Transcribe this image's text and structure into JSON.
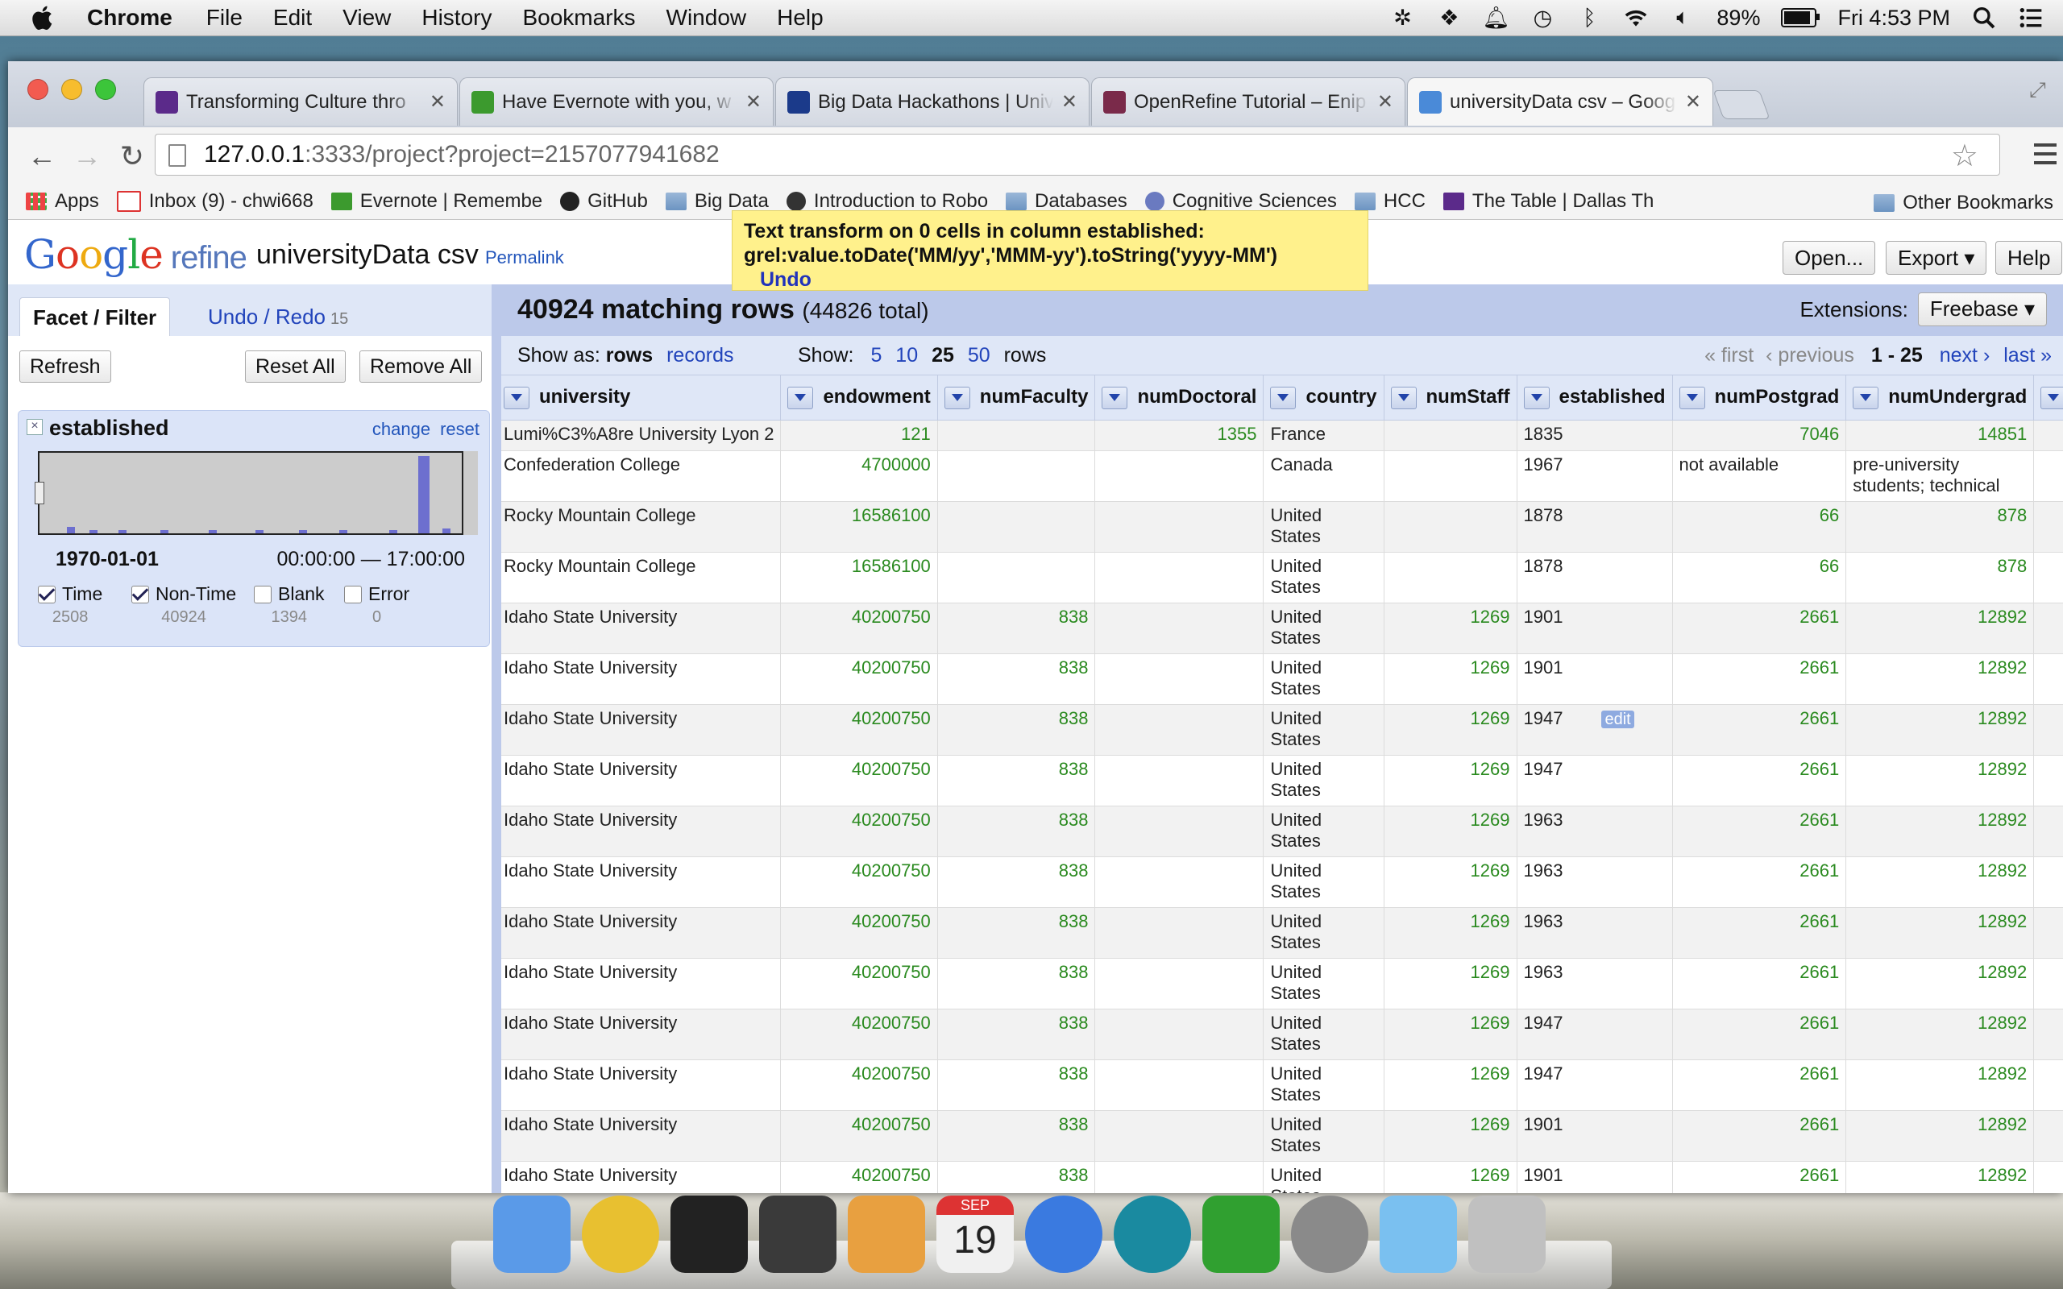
{
  "menubar": {
    "app_name": "Chrome",
    "items": [
      "File",
      "Edit",
      "View",
      "History",
      "Bookmarks",
      "Window",
      "Help"
    ],
    "battery_percent": "89%",
    "battery_level": 0.89,
    "clock": "Fri 4:53 PM"
  },
  "tabs": [
    {
      "title": "Transforming Culture thro",
      "active": false,
      "favicon_color": "#5b2a8a"
    },
    {
      "title": "Have Evernote with you, w",
      "active": false,
      "favicon_color": "#3c9a2e"
    },
    {
      "title": "Big Data Hackathons | Univ",
      "active": false,
      "favicon_color": "#1b3a8a"
    },
    {
      "title": "OpenRefine Tutorial – Enip",
      "active": false,
      "favicon_color": "#7a2a4a"
    },
    {
      "title": "universityData csv – Googl",
      "active": true,
      "favicon_color": "#4a8ad8"
    }
  ],
  "address": {
    "host": "127.0.0.1",
    "path": ":3333/project?project=2157077941682"
  },
  "bookmarks": [
    {
      "label": "Apps",
      "icon": "apps-grid-icon"
    },
    {
      "label": "Inbox (9) - chwi668",
      "icon": "gmail-icon"
    },
    {
      "label": "Evernote | Remembe",
      "icon": "evernote-icon"
    },
    {
      "label": "GitHub",
      "icon": "github-icon"
    },
    {
      "label": "Big Data",
      "icon": "folder-icon"
    },
    {
      "label": "Introduction to Robo",
      "icon": "robot-icon"
    },
    {
      "label": "Databases",
      "icon": "folder-icon"
    },
    {
      "label": "Cognitive Sciences",
      "icon": "gear-icon"
    },
    {
      "label": "HCC",
      "icon": "folder-icon"
    },
    {
      "label": "The Table | Dallas Th",
      "icon": "page-icon"
    }
  ],
  "other_bookmarks": "Other Bookmarks",
  "refine": {
    "logo_google": "Google",
    "logo_refine": "refine",
    "project_name": "universityData csv",
    "permalink": "Permalink",
    "notification_line1": "Text transform on 0 cells in column established:",
    "notification_line2": "grel:value.toDate('MM/yy','MMM-yy').toString('yyyy-MM')",
    "notification_undo": "Undo",
    "open_label": "Open...",
    "export_label": "Export ▾",
    "help_label": "Help"
  },
  "left": {
    "tab_facet": "Facet / Filter",
    "tab_undo": "Undo / Redo",
    "undo_count": "15",
    "refresh": "Refresh",
    "reset_all": "Reset All",
    "remove_all": "Remove All"
  },
  "facet": {
    "close": "×",
    "title": "established",
    "change": "change",
    "reset": "reset",
    "range_from": "1970-01-01",
    "range_to": "00:00:00 — 17:00:00",
    "checks": [
      {
        "label": "Time",
        "checked": true,
        "count": "2508"
      },
      {
        "label": "Non-Time",
        "checked": true,
        "count": "40924"
      },
      {
        "label": "Blank",
        "checked": false,
        "count": "1394"
      },
      {
        "label": "Error",
        "checked": false,
        "count": "0"
      }
    ]
  },
  "summary": {
    "matching": "40924 matching rows",
    "total": "(44826 total)",
    "extensions_label": "Extensions:",
    "extensions_btn": "Freebase ▾"
  },
  "viewbar": {
    "show_as": "Show as:",
    "rows": "rows",
    "records": "records",
    "show": "Show:",
    "sizes": [
      "5",
      "10",
      "25",
      "50"
    ],
    "rows_suffix": "rows",
    "first": "« first",
    "previous": "‹ previous",
    "range": "1 - 25",
    "next": "next ›",
    "last": "last »"
  },
  "grid": {
    "columns": [
      "university",
      "endowment",
      "numFaculty",
      "numDoctoral",
      "country",
      "numStaff",
      "established",
      "numPostgrad",
      "numUndergrad",
      "num"
    ],
    "rows": [
      [
        "Lumi%C3%A8re University Lyon 2",
        "121",
        "",
        "1355",
        "France",
        "",
        "1835",
        "7046",
        "14851"
      ],
      [
        "Confederation College",
        "4700000",
        "",
        "",
        "Canada",
        "",
        "1967",
        "not available",
        "pre-university students; technical"
      ],
      [
        "Rocky Mountain College",
        "16586100",
        "",
        "",
        "United States",
        "",
        "1878",
        "66",
        "878"
      ],
      [
        "Rocky Mountain College",
        "16586100",
        "",
        "",
        "United States",
        "",
        "1878",
        "66",
        "878"
      ],
      [
        "Idaho State University",
        "40200750",
        "838",
        "",
        "United States",
        "1269",
        "1901",
        "2661",
        "12892"
      ],
      [
        "Idaho State University",
        "40200750",
        "838",
        "",
        "United States",
        "1269",
        "1901",
        "2661",
        "12892"
      ],
      [
        "Idaho State University",
        "40200750",
        "838",
        "",
        "United States",
        "1269",
        "1947",
        "2661",
        "12892"
      ],
      [
        "Idaho State University",
        "40200750",
        "838",
        "",
        "United States",
        "1269",
        "1947",
        "2661",
        "12892"
      ],
      [
        "Idaho State University",
        "40200750",
        "838",
        "",
        "United States",
        "1269",
        "1963",
        "2661",
        "12892"
      ],
      [
        "Idaho State University",
        "40200750",
        "838",
        "",
        "United States",
        "1269",
        "1963",
        "2661",
        "12892"
      ],
      [
        "Idaho State University",
        "40200750",
        "838",
        "",
        "United States",
        "1269",
        "1963",
        "2661",
        "12892"
      ],
      [
        "Idaho State University",
        "40200750",
        "838",
        "",
        "United States",
        "1269",
        "1963",
        "2661",
        "12892"
      ],
      [
        "Idaho State University",
        "40200750",
        "838",
        "",
        "United States",
        "1269",
        "1947",
        "2661",
        "12892"
      ],
      [
        "Idaho State University",
        "40200750",
        "838",
        "",
        "United States",
        "1269",
        "1947",
        "2661",
        "12892"
      ],
      [
        "Idaho State University",
        "40200750",
        "838",
        "",
        "United States",
        "1269",
        "1901",
        "2661",
        "12892"
      ],
      [
        "Idaho State University",
        "40200750",
        "838",
        "",
        "United States",
        "1269",
        "1901",
        "2661",
        "12892"
      ]
    ],
    "edit_label": "edit"
  },
  "dock": [
    {
      "name": "finder-icon",
      "color": "#5a9ae8"
    },
    {
      "name": "chrome-icon",
      "color": "#e8c030"
    },
    {
      "name": "terminal-icon",
      "color": "#222222"
    },
    {
      "name": "sublime-text-icon",
      "color": "#3a3a3a"
    },
    {
      "name": "pages-icon",
      "color": "#e8a040"
    },
    {
      "name": "calendar-icon",
      "color": "#f0f0f0"
    },
    {
      "name": "itunes-icon",
      "color": "#3a7ae0"
    },
    {
      "name": "arduino-icon",
      "color": "#1a8aa0"
    },
    {
      "name": "iterm-icon",
      "color": "#30a030"
    },
    {
      "name": "system-preferences-icon",
      "color": "#8a8a8a"
    },
    {
      "name": "sketch-icon",
      "color": "#7ac0f0"
    },
    {
      "name": "trash-icon",
      "color": "#c0c0c0"
    }
  ],
  "dock_calendar_month": "SEP",
  "dock_calendar_day": "19"
}
